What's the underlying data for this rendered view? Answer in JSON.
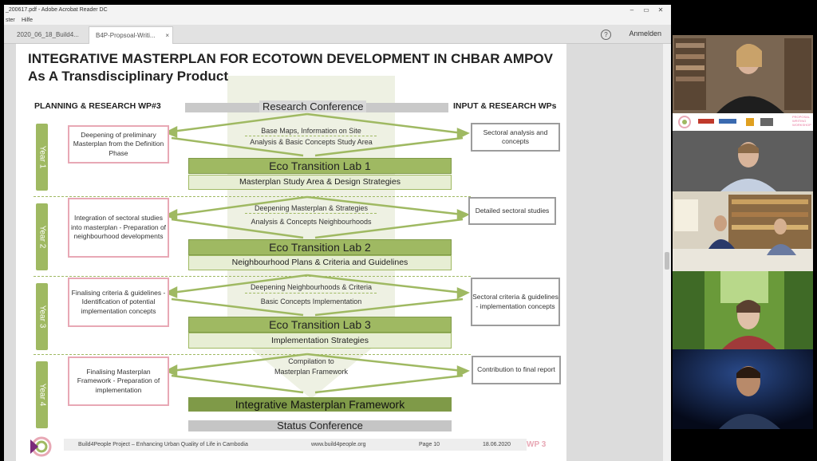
{
  "window": {
    "title": "_200617.pdf - Adobe Acrobat Reader DC",
    "menu_items": [
      "ster",
      "Hilfe"
    ]
  },
  "tabs": [
    {
      "label": "2020_06_18_Build4..."
    },
    {
      "label": "B4P-Propsoal-Writi...",
      "close": "×"
    }
  ],
  "toolbar": {
    "help": "?",
    "signin": "Anmelden"
  },
  "slide": {
    "title": "INTEGRATIVE MASTERPLAN FOR ECOTOWN DEVELOPMENT IN CHBAR AMPOV",
    "subtitle": "As A Transdisciplinary Product",
    "left_header": "PLANNING & RESEARCH WP#3",
    "right_header": "INPUT & RESEARCH WPs",
    "research_conference": "Research Conference",
    "status_conference": "Status Conference",
    "final": "Integrative Masterplan Framework",
    "years": [
      {
        "label": "Year 1",
        "left": "Deepening of preliminary Masterplan from the Definition Phase",
        "mid1": "Base Maps, Information on Site",
        "mid2": "Analysis & Basic Concepts Study Area",
        "right": "Sectoral analysis and concepts",
        "lab": "Eco Transition Lab 1",
        "labsub": "Masterplan Study Area & Design Strategies"
      },
      {
        "label": "Year 2",
        "left": "Integration of sectoral studies into masterplan - Preparation of neighbourhood developments",
        "mid1": "Deepening Masterplan & Strategies",
        "mid2": "Analysis & Concepts Neighbourhoods",
        "right": "Detailed sectoral studies",
        "lab": "Eco Transition Lab 2",
        "labsub": "Neighbourhood Plans & Criteria and Guidelines"
      },
      {
        "label": "Year 3",
        "left": "Finalising criteria & guidelines - Identification of potential implementation concepts",
        "mid1": "Deepening Neighbourhoods & Criteria",
        "mid2": "Basic Concepts Implementation",
        "right": "Sectoral criteria & guidelines - implementation concepts",
        "lab": "Eco Transition Lab 3",
        "labsub": "Implementation Strategies"
      },
      {
        "label": "Year 4",
        "left": "Finalising Masterplan Framework - Preparation of implementation",
        "mid1": "Compilation to",
        "mid2": "Masterplan Framework",
        "right": "Contribution to final report"
      }
    ],
    "footer": {
      "project": "Build4People Project – Enhancing Urban Quality of Life in Cambodia",
      "url": "www.build4people.org",
      "page": "Page 10",
      "date": "18.06.2020",
      "wp": "WP 3"
    }
  },
  "video": {
    "workshop_logo_text": "PROPOSAL WRITING WORKSHOP"
  },
  "colors": {
    "green": "#9fb962",
    "pink": "#e8a8b5",
    "gray": "#9c9c9c",
    "wp_pink": "#e8a8b5"
  }
}
